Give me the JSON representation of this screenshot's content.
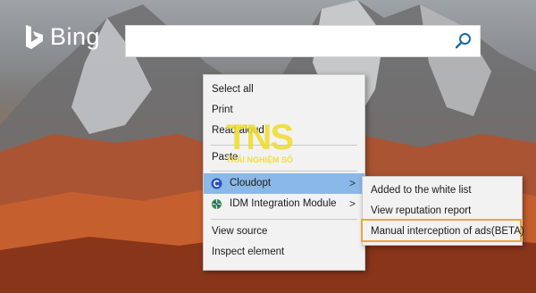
{
  "brand": {
    "name": "Bing"
  },
  "search": {
    "value": ""
  },
  "context_menu": {
    "items": [
      {
        "label": "Select all"
      },
      {
        "label": "Print"
      },
      {
        "label": "Read aloud"
      },
      {
        "label": "Paste"
      },
      {
        "label": "Cloudopt",
        "icon": "cloudopt-icon",
        "has_submenu": true,
        "highlighted": true
      },
      {
        "label": "IDM Integration Module",
        "icon": "idm-icon",
        "has_submenu": true
      },
      {
        "label": "View source"
      },
      {
        "label": "Inspect element"
      }
    ],
    "submenu_arrow": ">"
  },
  "submenu": {
    "items": [
      {
        "label": "Added to the white list"
      },
      {
        "label": "View reputation report"
      },
      {
        "label": "Manual interception of ads(BETA)",
        "emphasized": true
      }
    ]
  },
  "watermark": {
    "logo": "TNS",
    "text": "TRẢI NGHIỆM SỐ"
  },
  "colors": {
    "highlight": "#8ab8e8",
    "emphasis_border": "#e9a73a",
    "watermark": "#f0dc28"
  }
}
